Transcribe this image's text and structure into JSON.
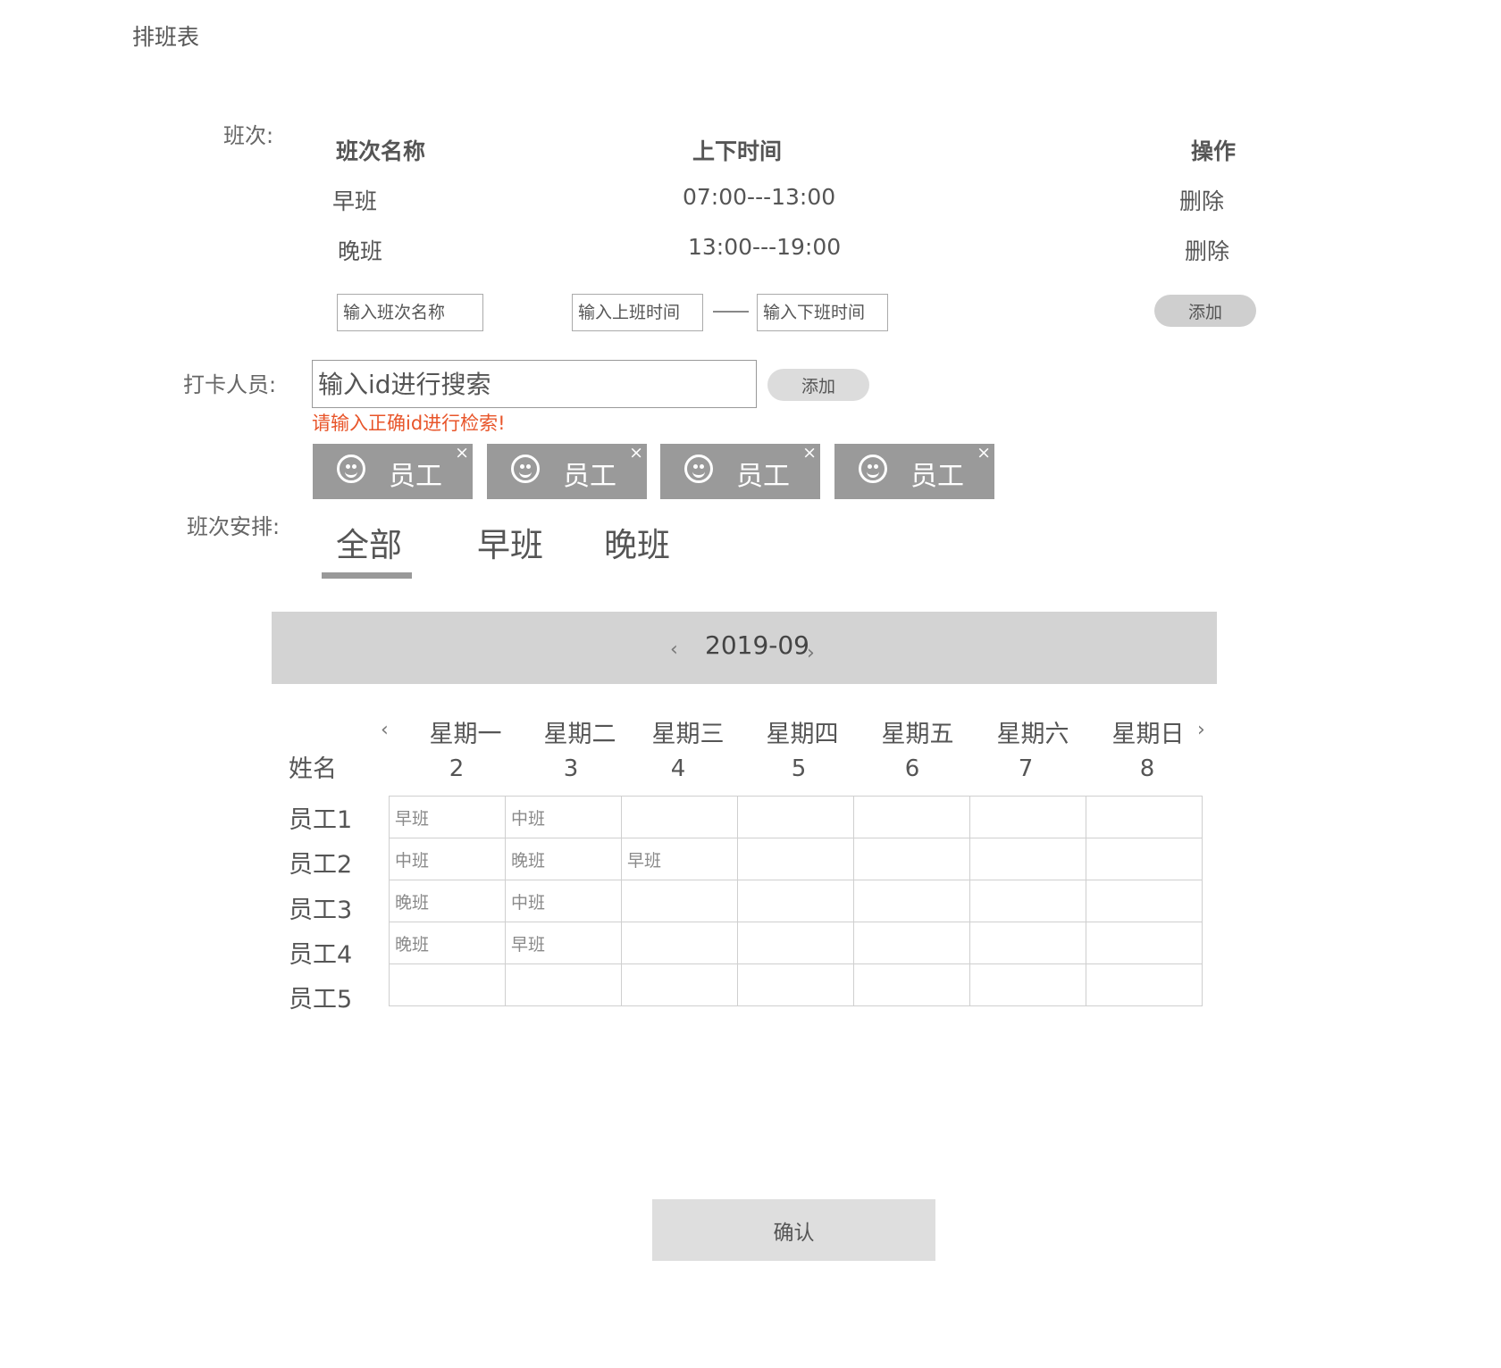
{
  "page": {
    "title": "排班表"
  },
  "shifts_section": {
    "label": "班次:",
    "headers": {
      "name": "班次名称",
      "time": "上下时间",
      "op": "操作"
    },
    "rows": [
      {
        "name": "早班",
        "time": "07:00---13:00",
        "op": "删除"
      },
      {
        "name": "晚班",
        "time": "13:00---19:00",
        "op": "删除"
      }
    ],
    "inputs": {
      "name_placeholder": "输入班次名称",
      "start_placeholder": "输入上班时间",
      "end_placeholder": "输入下班时间"
    },
    "add_label": "添加"
  },
  "staff_section": {
    "label": "打卡人员:",
    "search_placeholder": "输入id进行搜索",
    "add_label": "添加",
    "error": "请输入正确id进行检索!",
    "chips": [
      {
        "label": "员工",
        "icon": "smiley-icon",
        "close": "×"
      },
      {
        "label": "员工",
        "icon": "smiley-icon",
        "close": "×"
      },
      {
        "label": "员工",
        "icon": "smiley-icon",
        "close": "×"
      },
      {
        "label": "员工",
        "icon": "smiley-icon",
        "close": "×"
      }
    ]
  },
  "arrange_section": {
    "label": "班次安排:",
    "tabs": [
      {
        "label": "全部"
      },
      {
        "label": "早班"
      },
      {
        "label": "晚班"
      }
    ],
    "active_tab": "全部"
  },
  "calendar": {
    "month": "2019-09",
    "prev": "‹",
    "next": "›",
    "name_header": "姓名",
    "weekdays": [
      "星期一",
      "星期二",
      "星期三",
      "星期四",
      "星期五",
      "星期六",
      "星期日"
    ],
    "days": [
      "2",
      "3",
      "4",
      "5",
      "6",
      "7",
      "8"
    ],
    "employees": [
      "员工1",
      "员工2",
      "员工3",
      "员工4",
      "员工5"
    ],
    "schedule": [
      [
        "早班",
        "中班",
        "",
        "",
        "",
        "",
        ""
      ],
      [
        "中班",
        "晚班",
        "早班",
        "",
        "",
        "",
        ""
      ],
      [
        "晚班",
        "中班",
        "",
        "",
        "",
        "",
        ""
      ],
      [
        "晚班",
        "早班",
        "",
        "",
        "",
        "",
        ""
      ],
      [
        "",
        "",
        "",
        "",
        "",
        "",
        ""
      ]
    ]
  },
  "footer": {
    "confirm_label": "确认"
  },
  "colors": {
    "error": "#e8552a",
    "chip_bg": "#9a9a9a",
    "bar_bg": "#d3d3d3"
  }
}
